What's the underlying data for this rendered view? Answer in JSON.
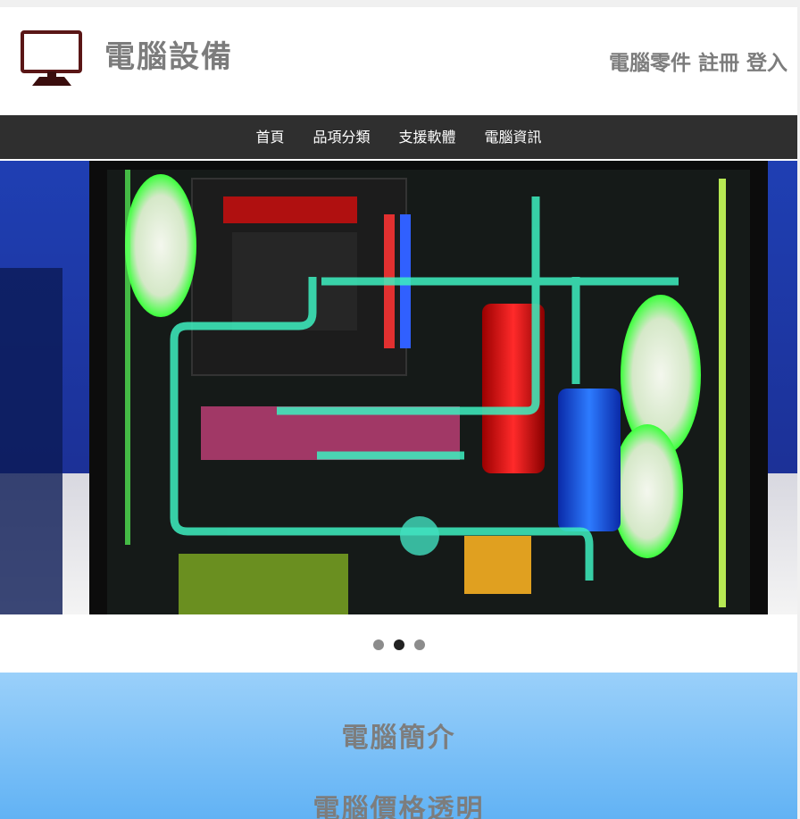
{
  "header": {
    "logo_icon": "monitor-icon",
    "title": "電腦設備",
    "links": {
      "parts": "電腦零件",
      "register": "註冊",
      "login": "登入"
    }
  },
  "nav": {
    "items": [
      "首頁",
      "品項分類",
      "支援軟體",
      "電腦資訊"
    ]
  },
  "carousel": {
    "image": "custom water-cooled PC build photo",
    "slide_count": 3,
    "active_index": 1
  },
  "intro": {
    "heading": "電腦簡介",
    "subheading": "電腦價格透明"
  },
  "colors": {
    "nav_bg": "#2f2f2f",
    "title_gray": "#7c7c7c",
    "logo_maroon": "#5a1616",
    "intro_gradient_top": "#9ad0fa",
    "intro_gradient_bottom": "#5fb1f4"
  }
}
